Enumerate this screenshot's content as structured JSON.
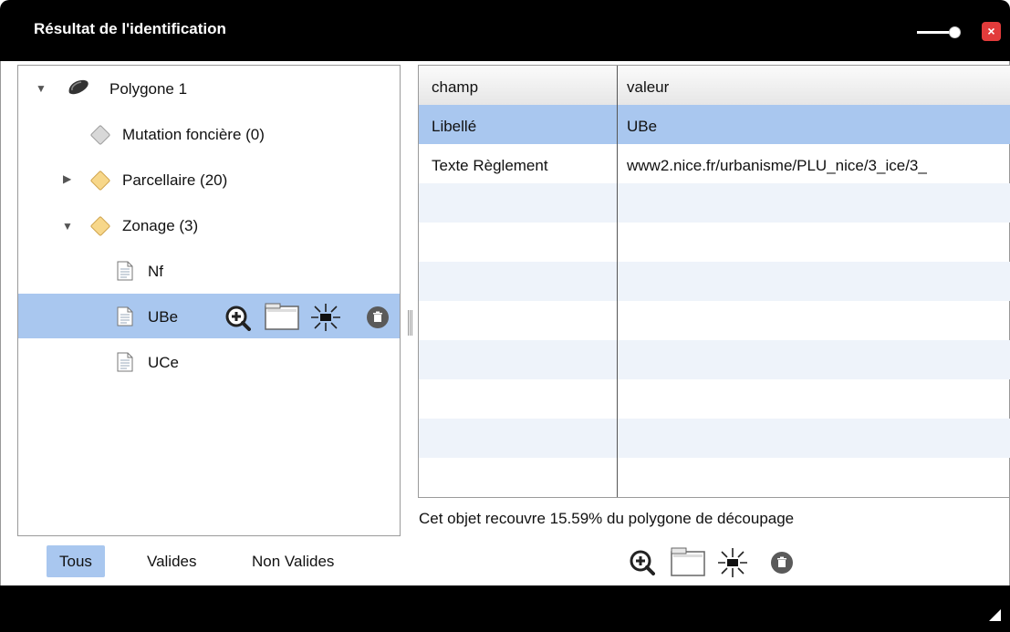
{
  "window": {
    "title": "Résultat de l'identification",
    "close_label": "×"
  },
  "tree": {
    "nodes": [
      {
        "label": "Polygone 1",
        "icon": "polygon-icon",
        "expanded": true
      },
      {
        "label": "Mutation foncière (0)",
        "icon": "grey-diamond-icon"
      },
      {
        "label": "Parcellaire (20)",
        "icon": "orange-diamond-icon",
        "expanded": false
      },
      {
        "label": "Zonage (3)",
        "icon": "orange-diamond-icon",
        "expanded": true
      },
      {
        "label": "Nf",
        "icon": "document-icon"
      },
      {
        "label": "UBe",
        "icon": "document-icon",
        "selected": true
      },
      {
        "label": "UCe",
        "icon": "document-icon"
      }
    ]
  },
  "table": {
    "headers": [
      "champ",
      "valeur"
    ],
    "rows": [
      {
        "champ": "Libellé",
        "valeur": "UBe"
      },
      {
        "champ": "Texte Règlement",
        "valeur": "www2.nice.fr/urbanisme/PLU_nice/3_ice/3_"
      }
    ]
  },
  "coverage_text": "Cet objet recouvre 15.59%  du polygone de découpage",
  "filters": [
    "Tous",
    "Valides",
    "Non Valides"
  ],
  "active_filter": "Tous",
  "colors": {
    "selection": "#a9c7ef",
    "title_bar": "#000000",
    "close": "#e23b3b"
  }
}
